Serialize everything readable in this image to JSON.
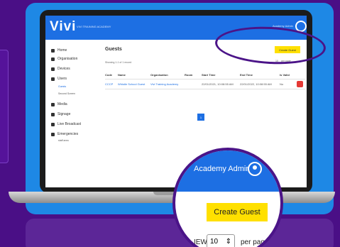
{
  "app": {
    "logo": "Vivi",
    "title": "VIVI TRAINING ACADEMY",
    "admin": "Academy Admin"
  },
  "sidebar": {
    "items": [
      {
        "label": "Home"
      },
      {
        "label": "Organisation"
      },
      {
        "label": "Devices"
      },
      {
        "label": "Users"
      },
      {
        "label": "Media"
      },
      {
        "label": "Signage"
      },
      {
        "label": "Live Broadcast"
      },
      {
        "label": "Emergencies"
      }
    ],
    "sub": [
      "Guests",
      "Second Screen",
      "staff area"
    ]
  },
  "main": {
    "title": "Guests",
    "create_label": "Create Guest",
    "showing": "Showing 1-1 of 1 record",
    "perpage_prefix": "10",
    "perpage_label": "per page",
    "columns": [
      "Code",
      "Name",
      "Organisation",
      "Room",
      "Start Time",
      "End Time",
      "Is Valid"
    ],
    "rows": [
      [
        "CCCP",
        "Whistle School Guest",
        "Vivi Training Academy",
        "",
        "22/01/2021, 10:08:55 AM",
        "22/01/2022, 10:08:55 AM",
        "No"
      ]
    ],
    "page": "1"
  },
  "zoom": {
    "admin": "Academy Admin",
    "create_label": "Create Guest",
    "view": "IEW",
    "select_value": "10",
    "perpage": "per pag"
  }
}
